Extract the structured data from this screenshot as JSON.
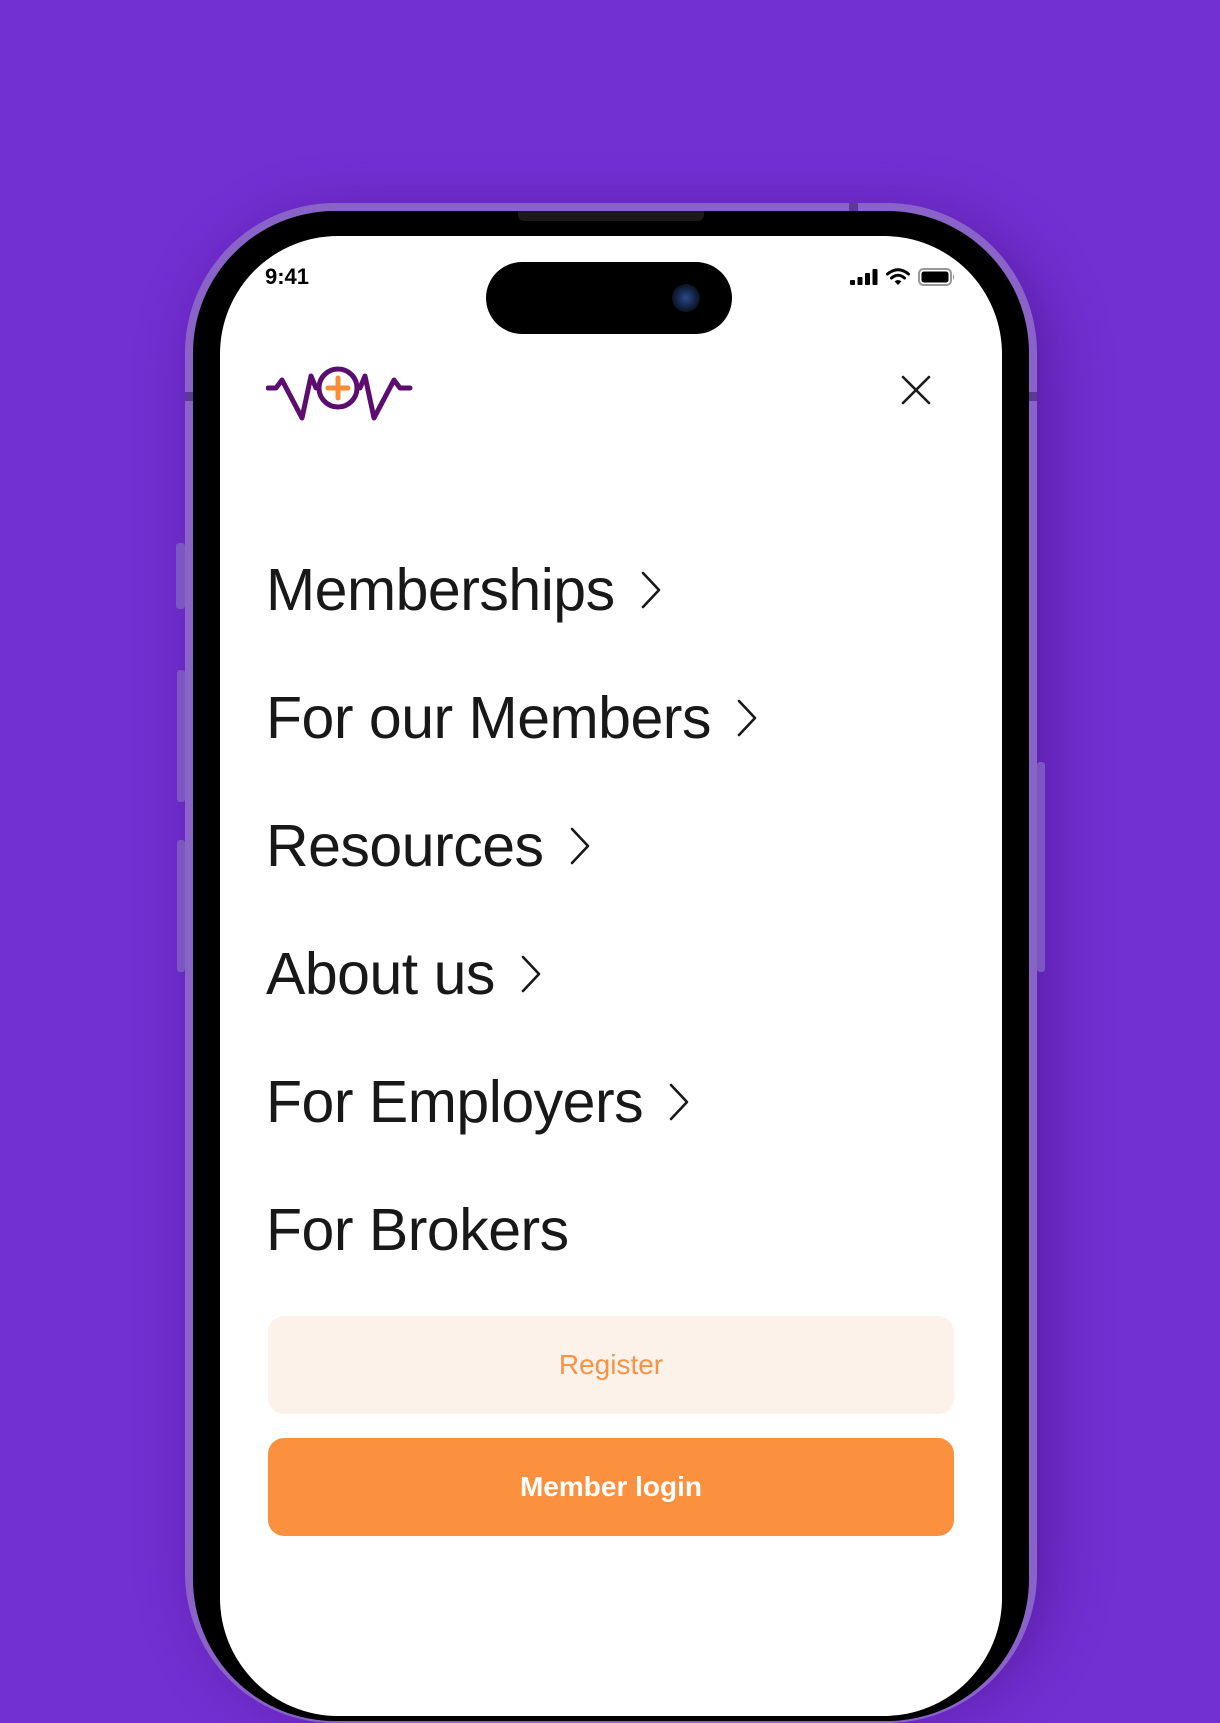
{
  "status_bar": {
    "time": "9:41"
  },
  "colors": {
    "background": "#722fd1",
    "logo_purple": "#5c0e6e",
    "logo_accent": "#fa8c36",
    "accent_orange": "#fb913e",
    "register_bg": "#fdf2ea",
    "register_text": "#f59346",
    "menu_text": "#181818"
  },
  "header": {
    "logo_icon": "wow-logo",
    "close_icon": "close-icon"
  },
  "menu": {
    "items": [
      {
        "label": "Memberships",
        "has_submenu": true
      },
      {
        "label": "For our Members",
        "has_submenu": true
      },
      {
        "label": "Resources",
        "has_submenu": true
      },
      {
        "label": "About us",
        "has_submenu": true
      },
      {
        "label": "For Employers",
        "has_submenu": true
      },
      {
        "label": "For Brokers",
        "has_submenu": false
      }
    ]
  },
  "actions": {
    "register_label": "Register",
    "login_label": "Member login"
  }
}
